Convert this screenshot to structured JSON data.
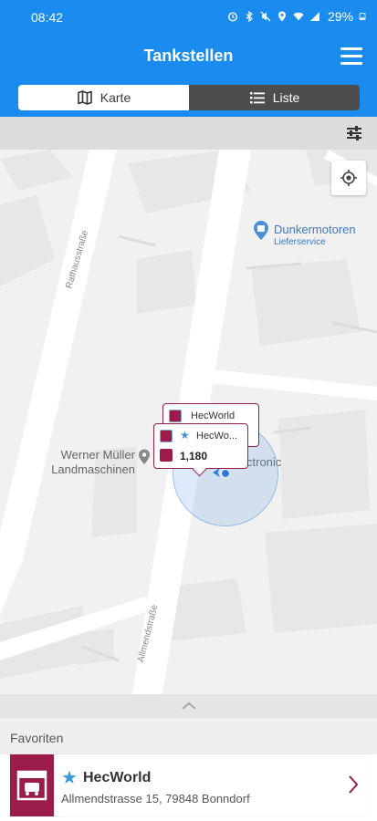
{
  "status_bar": {
    "time": "08:42",
    "battery": "29%"
  },
  "header": {
    "title": "Tankstellen"
  },
  "tabs": [
    {
      "label": "Karte",
      "icon": "map-icon",
      "selected": true
    },
    {
      "label": "Liste",
      "icon": "list-icon",
      "selected": false
    }
  ],
  "map": {
    "pois": [
      {
        "name": "Dunkermotoren",
        "sub": "Lieferservice"
      },
      {
        "name": "Werner Müller\nLandmaschinen"
      },
      {
        "name": "ctronic"
      }
    ],
    "streets": [
      "Rathausstraße",
      "Allmendstraße"
    ],
    "markers": [
      {
        "name": "HecWorld"
      },
      {
        "name": "HecWo...",
        "price": "1,180",
        "favorite": true
      }
    ]
  },
  "favorites": {
    "title": "Favoriten",
    "items": [
      {
        "name": "HecWorld",
        "address": "Allmendstrasse 15, 79848 Bonndorf"
      }
    ]
  },
  "colors": {
    "primary": "#1a8cf0",
    "brand": "#9b1c4b",
    "accent_star": "#3a9bd9"
  }
}
